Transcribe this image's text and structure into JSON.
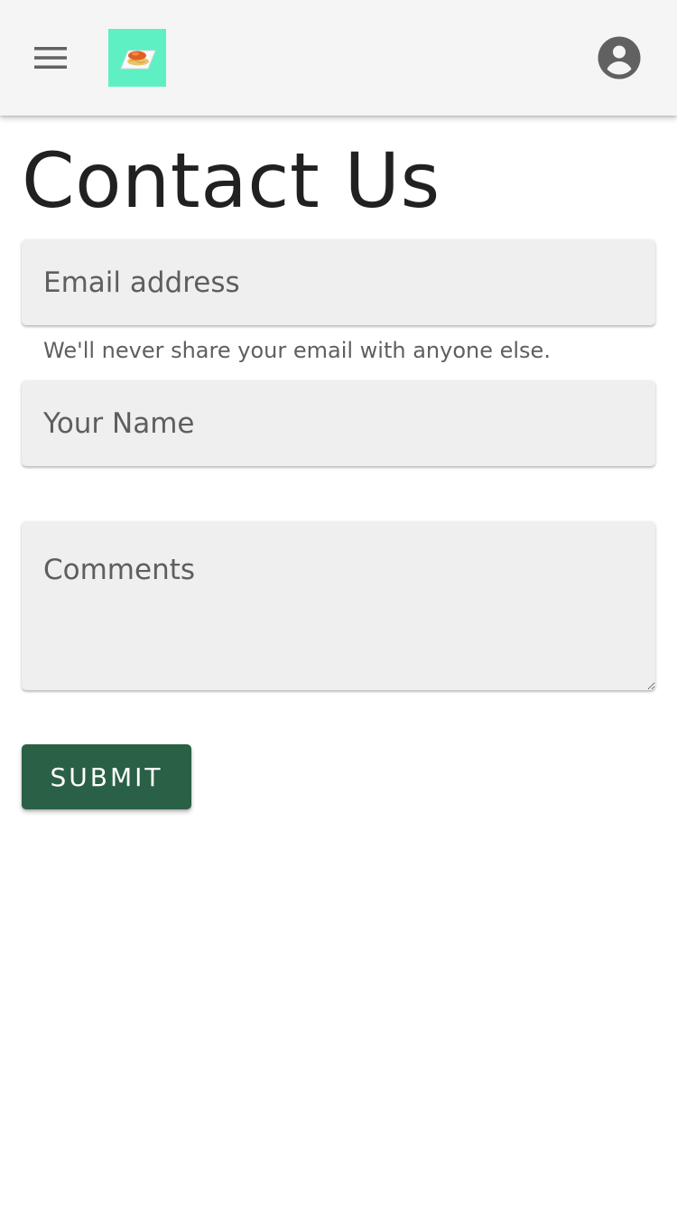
{
  "header": {
    "menu_icon": "hamburger-menu-icon",
    "logo_icon": "food-plate-logo-icon",
    "account_icon": "account-circle-icon",
    "logo_background": "#5ef0c3"
  },
  "page": {
    "title": "Contact Us"
  },
  "form": {
    "email": {
      "placeholder": "Email address",
      "value": "",
      "helper": "We'll never share your email with anyone else."
    },
    "name": {
      "placeholder": "Your Name",
      "value": ""
    },
    "comments": {
      "placeholder": "Comments",
      "value": ""
    },
    "submit_label": "SUBMIT"
  },
  "colors": {
    "app_bar": "#f5f5f5",
    "field_background": "#efefef",
    "submit_button": "#2a6045",
    "text_primary": "#212121",
    "text_secondary": "#5f5f5f"
  }
}
